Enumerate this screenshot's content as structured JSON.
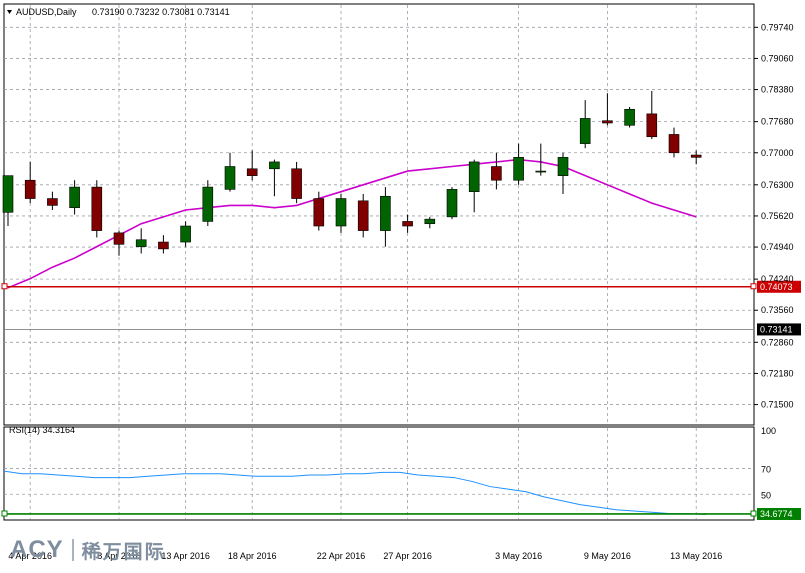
{
  "header": {
    "symbol": "AUDUSD,Daily",
    "ohlc": "0.73190 0.73232 0.73081 0.73141"
  },
  "rsi": {
    "label": "RSI(14) 34.3164"
  },
  "logo": {
    "brand": "ACY",
    "cn": "稀万国际"
  },
  "colors": {
    "background": "#ffffff",
    "bull": "#006400",
    "bear": "#800000",
    "ma": "#cc00cc",
    "hline": "#cc0000",
    "rsi_line": "#1e90ff",
    "rsi_level": "#008000"
  },
  "chart_data": {
    "type": "candlestick",
    "price_axis": {
      "ticks": [
        "0.79740",
        "0.79060",
        "0.78380",
        "0.77680",
        "0.77000",
        "0.76300",
        "0.75620",
        "0.74940",
        "0.74240",
        "0.73560",
        "0.72860",
        "0.72180",
        "0.71500"
      ],
      "range": [
        0.7125,
        0.799
      ]
    },
    "date_ticks": [
      {
        "label": "4 Apr 2016",
        "index": 1
      },
      {
        "label": "8 Apr 2016",
        "index": 5
      },
      {
        "label": "13 Apr 2016",
        "index": 8
      },
      {
        "label": "18 Apr 2016",
        "index": 11
      },
      {
        "label": "22 Apr 2016",
        "index": 15
      },
      {
        "label": "27 Apr 2016",
        "index": 18
      },
      {
        "label": "3 May 2016",
        "index": 23
      },
      {
        "label": "9 May 2016",
        "index": 27
      },
      {
        "label": "13 May 2016",
        "index": 31
      }
    ],
    "candles": [
      {
        "o": 0.757,
        "h": 0.765,
        "l": 0.754,
        "c": 0.765
      },
      {
        "o": 0.764,
        "h": 0.768,
        "l": 0.759,
        "c": 0.76
      },
      {
        "o": 0.76,
        "h": 0.7615,
        "l": 0.7575,
        "c": 0.7585
      },
      {
        "o": 0.758,
        "h": 0.764,
        "l": 0.7565,
        "c": 0.7625
      },
      {
        "o": 0.7625,
        "h": 0.764,
        "l": 0.7515,
        "c": 0.753
      },
      {
        "o": 0.7525,
        "h": 0.753,
        "l": 0.7475,
        "c": 0.75
      },
      {
        "o": 0.7495,
        "h": 0.7535,
        "l": 0.748,
        "c": 0.751
      },
      {
        "o": 0.7505,
        "h": 0.752,
        "l": 0.748,
        "c": 0.749
      },
      {
        "o": 0.7505,
        "h": 0.755,
        "l": 0.7495,
        "c": 0.754
      },
      {
        "o": 0.755,
        "h": 0.764,
        "l": 0.754,
        "c": 0.7625
      },
      {
        "o": 0.762,
        "h": 0.77,
        "l": 0.7615,
        "c": 0.767
      },
      {
        "o": 0.7665,
        "h": 0.7705,
        "l": 0.764,
        "c": 0.765
      },
      {
        "o": 0.7665,
        "h": 0.7685,
        "l": 0.7605,
        "c": 0.768
      },
      {
        "o": 0.7665,
        "h": 0.768,
        "l": 0.759,
        "c": 0.76
      },
      {
        "o": 0.76,
        "h": 0.7615,
        "l": 0.753,
        "c": 0.754
      },
      {
        "o": 0.754,
        "h": 0.761,
        "l": 0.7525,
        "c": 0.76
      },
      {
        "o": 0.7595,
        "h": 0.761,
        "l": 0.7515,
        "c": 0.753
      },
      {
        "o": 0.753,
        "h": 0.7625,
        "l": 0.7495,
        "c": 0.7605
      },
      {
        "o": 0.755,
        "h": 0.7565,
        "l": 0.7525,
        "c": 0.754
      },
      {
        "o": 0.7545,
        "h": 0.756,
        "l": 0.7535,
        "c": 0.7555
      },
      {
        "o": 0.756,
        "h": 0.7625,
        "l": 0.7555,
        "c": 0.762
      },
      {
        "o": 0.7615,
        "h": 0.7685,
        "l": 0.757,
        "c": 0.768
      },
      {
        "o": 0.767,
        "h": 0.77,
        "l": 0.762,
        "c": 0.764
      },
      {
        "o": 0.764,
        "h": 0.772,
        "l": 0.763,
        "c": 0.769
      },
      {
        "o": 0.766,
        "h": 0.772,
        "l": 0.765,
        "c": 0.766
      },
      {
        "o": 0.765,
        "h": 0.77,
        "l": 0.761,
        "c": 0.769
      },
      {
        "o": 0.772,
        "h": 0.7815,
        "l": 0.771,
        "c": 0.7775
      },
      {
        "o": 0.777,
        "h": 0.783,
        "l": 0.776,
        "c": 0.7765
      },
      {
        "o": 0.776,
        "h": 0.78,
        "l": 0.7755,
        "c": 0.7795
      },
      {
        "o": 0.7785,
        "h": 0.7835,
        "l": 0.773,
        "c": 0.7735
      },
      {
        "o": 0.774,
        "h": 0.7755,
        "l": 0.769,
        "c": 0.77
      },
      {
        "o": 0.7695,
        "h": 0.7705,
        "l": 0.7675,
        "c": 0.769
      }
    ],
    "ma_line": [
      0.7405,
      0.7425,
      0.745,
      0.747,
      0.7495,
      0.752,
      0.7545,
      0.756,
      0.7575,
      0.758,
      0.7585,
      0.7585,
      0.758,
      0.7585,
      0.76,
      0.7615,
      0.763,
      0.7645,
      0.766,
      0.7665,
      0.767,
      0.7675,
      0.768,
      0.7685,
      0.768,
      0.767,
      0.765,
      0.763,
      0.761,
      0.759,
      0.7575,
      0.756
    ],
    "hline": {
      "value": 0.74073,
      "label": "0.74073"
    },
    "last_price": {
      "value": 0.73141,
      "label": "0.73141"
    },
    "rsi": {
      "ticks": [
        "100",
        "70",
        "50"
      ],
      "range": [
        30,
        100
      ],
      "level": {
        "value": 34.6774,
        "label": "34.6774"
      },
      "values": [
        68,
        66,
        66,
        65,
        64,
        63,
        63,
        63,
        64,
        65,
        66,
        66,
        66,
        65,
        64,
        64,
        64,
        65,
        65,
        66,
        66,
        67,
        67,
        65,
        64,
        63,
        60,
        56,
        54,
        52,
        48,
        45,
        42,
        40,
        38,
        37,
        36,
        35,
        35,
        34.3
      ]
    }
  }
}
